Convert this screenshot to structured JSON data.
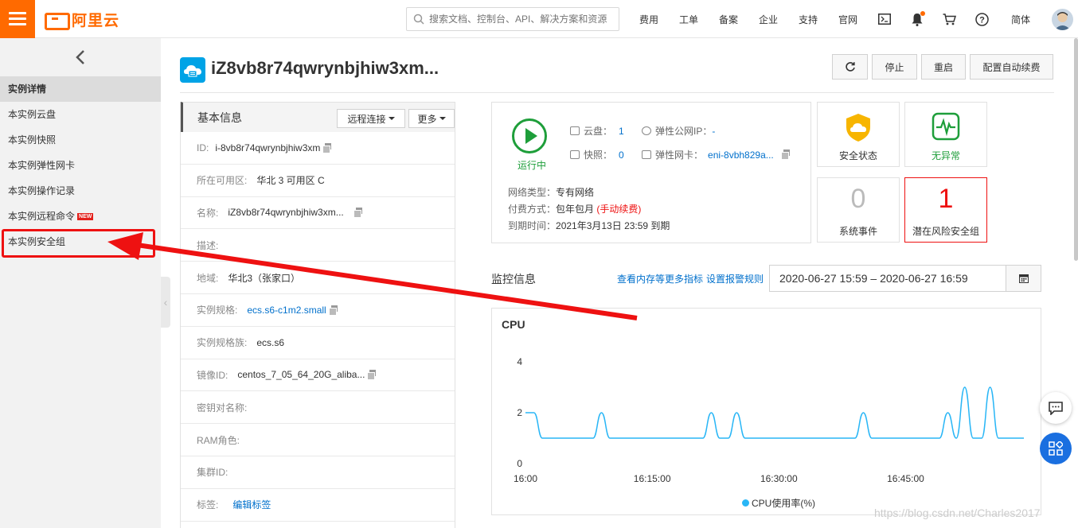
{
  "topbar": {
    "brand": "阿里云",
    "search_placeholder": "搜索文档、控制台、API、解决方案和资源",
    "nav": [
      "费用",
      "工单",
      "备案",
      "企业",
      "支持",
      "官网"
    ],
    "lang": "简体",
    "icons": [
      "terminal-icon",
      "bell-icon",
      "cart-icon",
      "help-icon"
    ],
    "accent": "#ff6a00"
  },
  "sidebar": {
    "items": [
      {
        "label": "实例详情"
      },
      {
        "label": "本实例云盘"
      },
      {
        "label": "本实例快照"
      },
      {
        "label": "本实例弹性网卡"
      },
      {
        "label": "本实例操作记录"
      },
      {
        "label": "本实例远程命令",
        "badge": "NEW"
      },
      {
        "label": "本实例安全组"
      }
    ]
  },
  "header": {
    "title": "iZ8vb8r74qwrynbjhiw3xm...",
    "buttons": {
      "stop": "停止",
      "restart": "重启",
      "auto_renew": "配置自动续费"
    }
  },
  "basic": {
    "title": "基本信息",
    "remote": "远程连接",
    "more": "更多",
    "rows": [
      {
        "k": "ID:",
        "v": "i-8vb8r74qwrynbjhiw3xm"
      },
      {
        "k": "所在可用区:",
        "v": "华北 3 可用区 C"
      },
      {
        "k": "名称:",
        "v": "iZ8vb8r74qwrynbjhiw3xm..."
      },
      {
        "k": "描述:",
        "v": ""
      },
      {
        "k": "地域:",
        "v": "华北3（张家口）"
      },
      {
        "k": "实例规格:",
        "v": "ecs.s6-c1m2.small"
      },
      {
        "k": "实例规格族:",
        "v": "ecs.s6"
      },
      {
        "k": "镜像ID:",
        "v": "centos_7_05_64_20G_aliba..."
      },
      {
        "k": "密钥对名称:",
        "v": ""
      },
      {
        "k": "RAM角色:",
        "v": ""
      },
      {
        "k": "集群ID:",
        "v": ""
      },
      {
        "k": "标签:",
        "v": "编辑标签"
      }
    ]
  },
  "status": {
    "running": "运行中",
    "disk_k": "云盘：",
    "disk_v": "1",
    "snap_k": "快照：",
    "snap_v": "0",
    "eip_k": "弹性公网IP：",
    "eip_v": "-",
    "eni_k": "弹性网卡：",
    "eni_v": "eni-8vbh829a...",
    "net_k": "网络类型：",
    "net_v": "专有网络",
    "pay_k": "付费方式：",
    "pay_v": "包年包月",
    "pay_note": "(手动续费)",
    "exp_k": "到期时间：",
    "exp_v": "2021年3月13日 23:59 到期"
  },
  "tiles": {
    "security": "安全状态",
    "normal": "无异常",
    "events_count": "0",
    "events": "系统事件",
    "risk_count": "1",
    "risk": "潜在风险安全组"
  },
  "monitor": {
    "title": "监控信息",
    "link1": "查看内存等更多指标",
    "link2": "设置报警规则",
    "date_range": "2020-06-27 15:59  –  2020-06-27 16:59"
  },
  "chart_data": {
    "type": "line",
    "title": "CPU",
    "series": [
      {
        "name": "CPU使用率(%)",
        "x": [
          "16:00",
          "16:01",
          "16:02",
          "16:03",
          "16:04",
          "16:05",
          "16:06",
          "16:07",
          "16:08",
          "16:09",
          "16:10",
          "16:11",
          "16:12",
          "16:13",
          "16:14",
          "16:15",
          "16:16",
          "16:17",
          "16:18",
          "16:19",
          "16:20",
          "16:21",
          "16:22",
          "16:23",
          "16:24",
          "16:25",
          "16:26",
          "16:27",
          "16:28",
          "16:29",
          "16:30",
          "16:31",
          "16:32",
          "16:33",
          "16:34",
          "16:35",
          "16:36",
          "16:37",
          "16:38",
          "16:39",
          "16:40",
          "16:41",
          "16:42",
          "16:43",
          "16:44",
          "16:45",
          "16:46",
          "16:47",
          "16:48",
          "16:49",
          "16:50",
          "16:51",
          "16:52",
          "16:53",
          "16:54",
          "16:55",
          "16:56",
          "16:57",
          "16:58",
          "16:59"
        ],
        "values": [
          2,
          2,
          1,
          1,
          1,
          1,
          1,
          1,
          1,
          2,
          1,
          1,
          1,
          1,
          1,
          1,
          1,
          1,
          1,
          1,
          1,
          1,
          2,
          1,
          1,
          2,
          1,
          1,
          1,
          1,
          1,
          1,
          1,
          1,
          1,
          1,
          1,
          1,
          1,
          1,
          2,
          1,
          1,
          1,
          1,
          1,
          1,
          1,
          1,
          1,
          2,
          1,
          3,
          1,
          1,
          3,
          1,
          1,
          1,
          1
        ]
      }
    ],
    "x_ticks": [
      "16:00",
      "16:15:00",
      "16:30:00",
      "16:45:00"
    ],
    "y_ticks": [
      0,
      2,
      4
    ],
    "ylim": [
      0,
      4
    ],
    "grid": false,
    "legend": "bottom",
    "color": "#29b6f6"
  },
  "watermark": "https://blog.csdn.net/Charles2017"
}
